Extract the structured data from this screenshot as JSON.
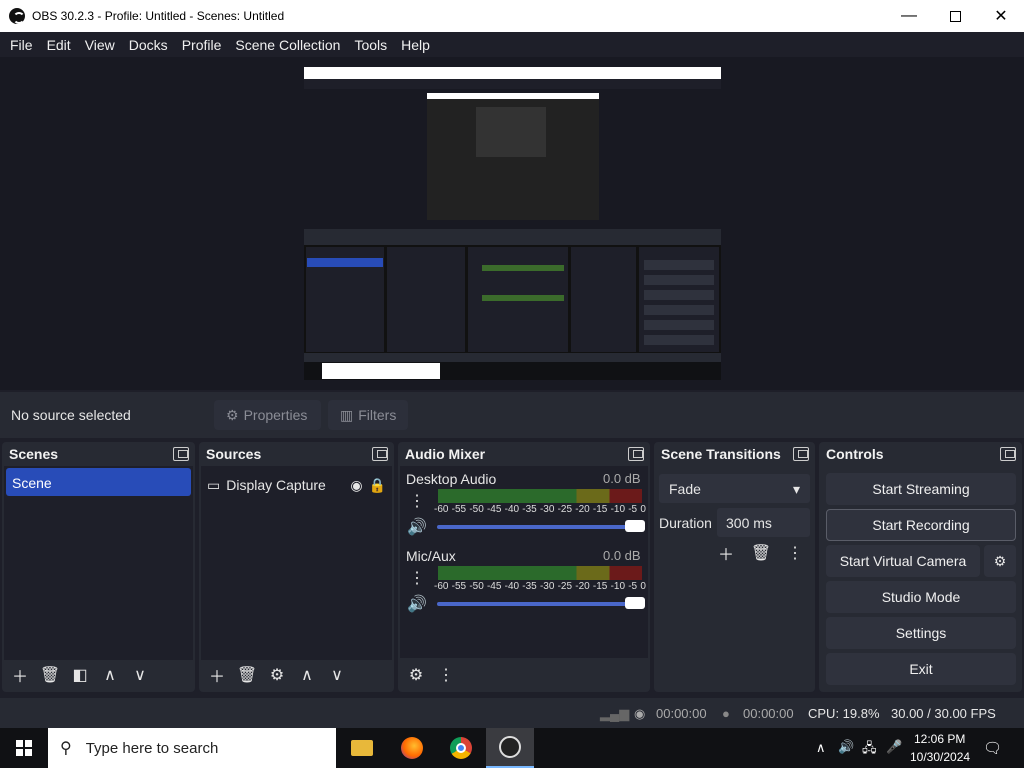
{
  "window": {
    "title": "OBS 30.2.3 - Profile: Untitled - Scenes: Untitled"
  },
  "menu": [
    "File",
    "Edit",
    "View",
    "Docks",
    "Profile",
    "Scene Collection",
    "Tools",
    "Help"
  ],
  "source_bar": {
    "status": "No source selected",
    "properties": "Properties",
    "filters": "Filters"
  },
  "scenes": {
    "title": "Scenes",
    "items": [
      "Scene"
    ]
  },
  "sources": {
    "title": "Sources",
    "items": [
      "Display Capture"
    ]
  },
  "audio_mixer": {
    "title": "Audio Mixer",
    "channels": [
      {
        "name": "Desktop Audio",
        "level": "0.0 dB",
        "volume": 1.0
      },
      {
        "name": "Mic/Aux",
        "level": "0.0 dB",
        "volume": 1.0
      }
    ],
    "scale": [
      "-60",
      "-55",
      "-50",
      "-45",
      "-40",
      "-35",
      "-30",
      "-25",
      "-20",
      "-15",
      "-10",
      "-5",
      "0"
    ]
  },
  "scene_transitions": {
    "title": "Scene Transitions",
    "transition": "Fade",
    "duration_label": "Duration",
    "duration": "300 ms"
  },
  "controls": {
    "title": "Controls",
    "buttons": [
      "Start Streaming",
      "Start Recording",
      "Start Virtual Camera",
      "Studio Mode",
      "Settings",
      "Exit"
    ]
  },
  "status": {
    "stream_time": "00:00:00",
    "record_time": "00:00:00",
    "cpu": "CPU: 19.8%",
    "fps": "30.00 / 30.00 FPS"
  },
  "taskbar": {
    "search_placeholder": "Type here to search",
    "time": "12:06 PM",
    "date": "10/30/2024"
  },
  "icons": [
    "obs-icon",
    "minimize-icon",
    "maximize-icon",
    "close-icon",
    "gear-icon",
    "filter-icon",
    "monitor-icon",
    "eye-icon",
    "lock-icon",
    "speaker-icon",
    "kebab-icon",
    "plus-icon",
    "trash-icon",
    "arrow-up-icon",
    "arrow-down-icon",
    "windows-start-icon",
    "search-icon",
    "folder-icon",
    "firefox-icon",
    "chrome-icon"
  ]
}
